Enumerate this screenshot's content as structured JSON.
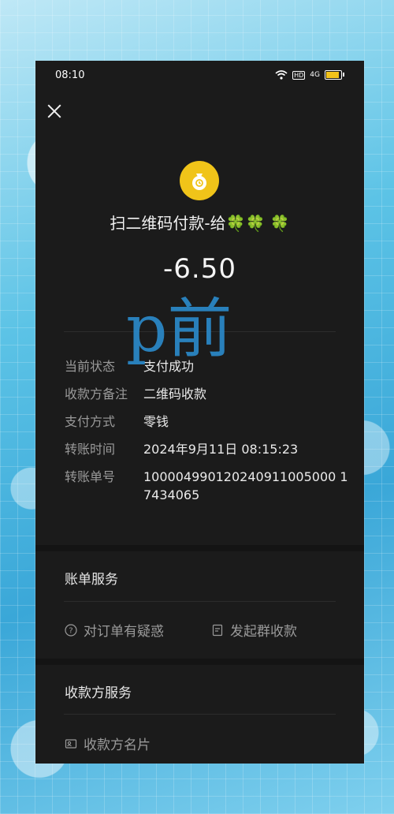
{
  "status_bar": {
    "time": "08:10",
    "hd": "HD",
    "signal": "4G"
  },
  "header": {
    "title": "扫二维码付款-给🍀🍀 🍀",
    "amount": "-6.50"
  },
  "watermark": "p前",
  "details": [
    {
      "label": "当前状态",
      "value": "支付成功"
    },
    {
      "label": "收款方备注",
      "value": "二维码收款"
    },
    {
      "label": "支付方式",
      "value": "零钱"
    },
    {
      "label": "转账时间",
      "value": "2024年9月11日 08:15:23"
    },
    {
      "label": "转账单号",
      "value": "100004990120240911005000 17434065"
    }
  ],
  "bill_service": {
    "title": "账单服务",
    "items": [
      {
        "label": "对订单有疑惑"
      },
      {
        "label": "发起群收款"
      }
    ]
  },
  "payee_service": {
    "title": "收款方服务",
    "items": [
      {
        "label": "收款方名片"
      }
    ]
  },
  "colors": {
    "accent": "#f0c419",
    "watermark": "#2a86c4",
    "background": "#1b1b1b"
  }
}
